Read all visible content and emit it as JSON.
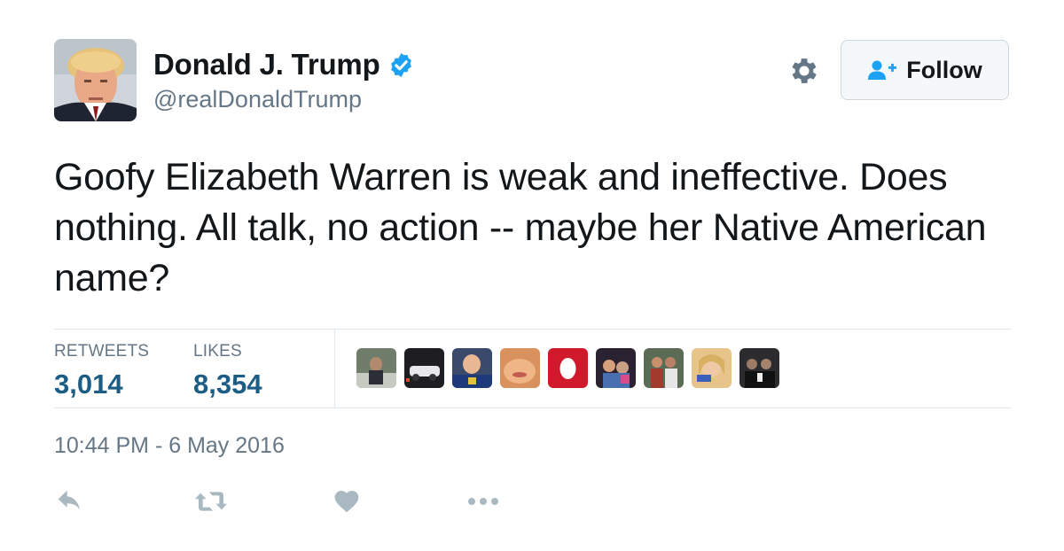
{
  "author": {
    "name": "Donald J. Trump",
    "handle": "@realDonaldTrump",
    "verified": true
  },
  "header": {
    "follow_label": "Follow",
    "settings_icon": "gear-icon"
  },
  "tweet": {
    "text": "Goofy Elizabeth Warren is weak and ineffective. Does nothing. All talk, no action -- maybe her Native American name?"
  },
  "stats": {
    "retweets_label": "RETWEETS",
    "retweets_value": "3,014",
    "likes_label": "LIKES",
    "likes_value": "8,354"
  },
  "likers_count": 9,
  "timestamp": "10:44 PM - 6 May 2016",
  "actions": [
    "reply-icon",
    "retweet-icon",
    "heart-icon",
    "more-icon"
  ],
  "colors": {
    "text": "#14171a",
    "muted": "#657786",
    "stat_value": "#1c5d86",
    "verified": "#1da1f2",
    "action_icon": "#aab8c2",
    "divider": "#e1e8ed"
  }
}
